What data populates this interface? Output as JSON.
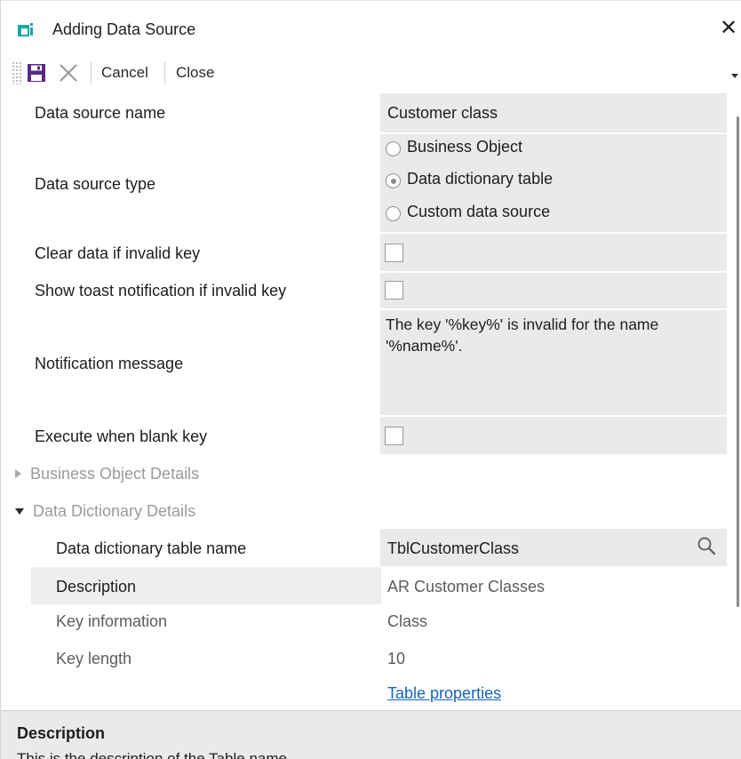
{
  "window": {
    "title": "Adding Data Source",
    "close_glyph": "✕",
    "accent_color": "#1aa6a6"
  },
  "toolbar": {
    "cancel_label": "Cancel",
    "close_label": "Close",
    "icons": [
      "save-icon",
      "cancel-x-icon"
    ]
  },
  "fields": {
    "data_source_name": {
      "label": "Data source name",
      "value": "Customer class"
    },
    "data_source_type": {
      "label": "Data source type",
      "options": [
        {
          "label": "Business Object",
          "checked": false
        },
        {
          "label": "Data dictionary table",
          "checked": true
        },
        {
          "label": "Custom data source",
          "checked": false
        }
      ]
    },
    "clear_data": {
      "label": "Clear data if invalid key",
      "checked": false
    },
    "show_toast": {
      "label": "Show toast notification if invalid key",
      "checked": false
    },
    "notification_message": {
      "label": "Notification message",
      "value": "The key '%key%' is invalid for the name '%name%'."
    },
    "execute_blank": {
      "label": "Execute when blank key",
      "checked": false
    }
  },
  "groups": {
    "business_object": {
      "label": "Business Object Details",
      "expanded": false
    },
    "data_dictionary": {
      "label": "Data Dictionary Details",
      "expanded": true
    }
  },
  "dd_details": {
    "table_name": {
      "label": "Data dictionary table name",
      "value": "TblCustomerClass"
    },
    "description": {
      "label": "Description",
      "value": "AR Customer Classes"
    },
    "key_information": {
      "label": "Key information",
      "value": "Class"
    },
    "key_length": {
      "label": "Key length",
      "value": "10"
    },
    "table_properties_link": "Table properties"
  },
  "description_panel": {
    "title": "Description",
    "body": "This is the description of the Table name"
  }
}
